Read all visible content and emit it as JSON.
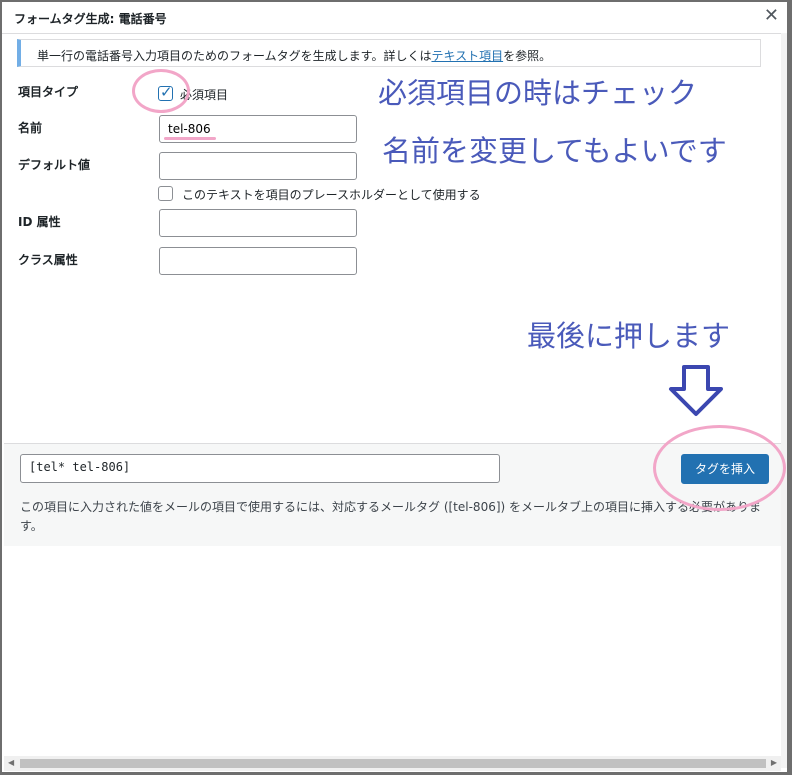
{
  "dialog": {
    "title": "フォームタグ生成: 電話番号",
    "close_icon": "close-icon"
  },
  "notice": {
    "text_before": "単一行の電話番号入力項目のためのフォームタグを生成します。詳しくは",
    "link": "テキスト項目",
    "text_after": "を参照。"
  },
  "form": {
    "type_label": "項目タイプ",
    "required_label": "必須項目",
    "required_checked": true,
    "name_label": "名前",
    "name_value": "tel-806",
    "default_label": "デフォルト値",
    "default_value": "",
    "placeholder_label": "このテキストを項目のプレースホルダーとして使用する",
    "placeholder_checked": false,
    "id_label": "ID 属性",
    "id_value": "",
    "class_label": "クラス属性",
    "class_value": ""
  },
  "footer": {
    "tag_code": "[tel* tel-806]",
    "insert_button": "タグを挿入",
    "note": "この項目に入力された値をメールの項目で使用するには、対応するメールタグ ([tel-806]) をメールタブ上の項目に挿入する必要があります。"
  },
  "annotations": {
    "required": "必須項目の時はチェック",
    "name": "名前を変更してもよいです",
    "press": "最後に押します",
    "color": "#4a5aba",
    "highlight_color": "#f2a6c8"
  }
}
